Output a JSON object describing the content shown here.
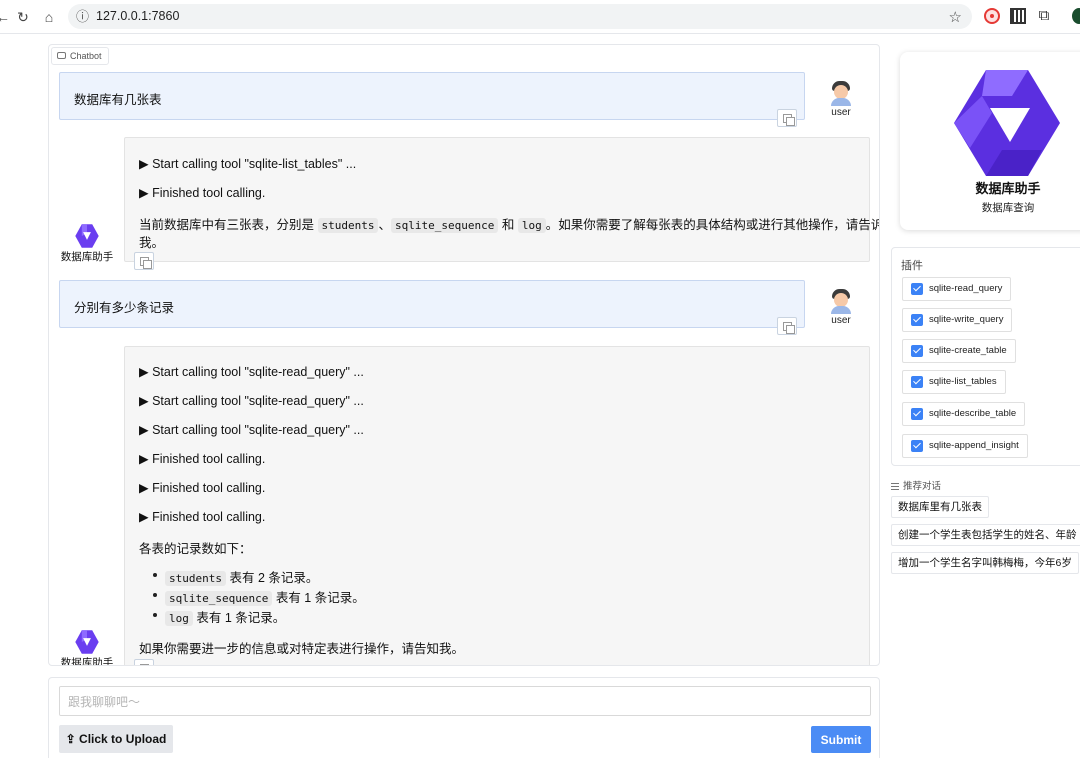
{
  "browser": {
    "url": "127.0.0.1:7860"
  },
  "chatbot": {
    "tag": "Chatbot",
    "messages": [
      {
        "role": "user",
        "name": "user",
        "text": "数据库有几张表"
      },
      {
        "role": "bot",
        "name": "数据库助手",
        "tool_lines": [
          "▶ Start calling tool \"sqlite-list_tables\" ...",
          "▶ Finished tool calling."
        ],
        "answer": {
          "pre": "当前数据库中有三张表，分别是",
          "codes": [
            "students",
            "sqlite_sequence",
            "log"
          ],
          "sep1": "、",
          "sep2": "和",
          "post": "。如果你需要了解每张表的具体结构或进行其他操作，请告诉",
          "line2": "我。"
        }
      },
      {
        "role": "user",
        "name": "user",
        "text": "分别有多少条记录"
      },
      {
        "role": "bot",
        "name": "数据库助手",
        "tool_lines": [
          "▶ Start calling tool \"sqlite-read_query\" ...",
          "▶ Start calling tool \"sqlite-read_query\" ...",
          "▶ Start calling tool \"sqlite-read_query\" ...",
          "▶ Finished tool calling.",
          "▶ Finished tool calling.",
          "▶ Finished tool calling."
        ],
        "summary": "各表的记录数如下：",
        "records": [
          {
            "table": "students",
            "text": "表有 2 条记录。"
          },
          {
            "table": "sqlite_sequence",
            "text": "表有 1 条记录。"
          },
          {
            "table": "log",
            "text": "表有 1 条记录。"
          }
        ],
        "closing": "如果你需要进一步的信息或对特定表进行操作，请告知我。"
      }
    ]
  },
  "input": {
    "placeholder": "跟我聊聊吧～",
    "upload_label": "Click to Upload",
    "upload_icon": "upload-icon",
    "submit_label": "Submit"
  },
  "agent": {
    "name": "数据库助手",
    "description": "数据库查询"
  },
  "plugins": {
    "title": "插件",
    "items": [
      {
        "label": "sqlite-read_query",
        "checked": true
      },
      {
        "label": "sqlite-write_query",
        "checked": true
      },
      {
        "label": "sqlite-create_table",
        "checked": true
      },
      {
        "label": "sqlite-list_tables",
        "checked": true
      },
      {
        "label": "sqlite-describe_table",
        "checked": true
      },
      {
        "label": "sqlite-append_insight",
        "checked": true
      }
    ]
  },
  "suggestions": {
    "title": "推荐对话",
    "items": [
      "数据库里有几张表",
      "创建一个学生表包括学生的姓名、年龄",
      "增加一个学生名字叫韩梅梅，今年6岁"
    ]
  },
  "colors": {
    "accent": "#4b8cf5",
    "user_bubble": "#edf3fd",
    "bot_bubble": "#f6f6f6",
    "logo": "#6a3ef0"
  }
}
